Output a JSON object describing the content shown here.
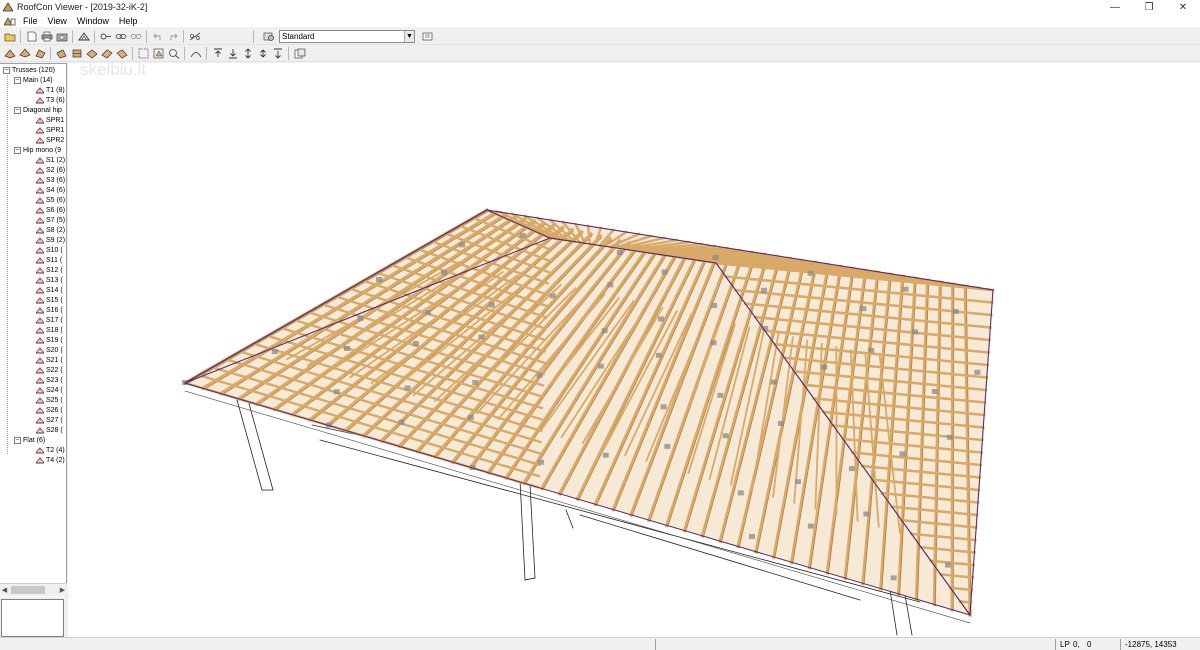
{
  "window": {
    "title": "RoofCon Viewer - [2019-32-iK-2]",
    "controls": {
      "minimize": "—",
      "restore": "❐",
      "close": "✕"
    }
  },
  "menu": [
    "File",
    "View",
    "Window",
    "Help"
  ],
  "toolbar": {
    "view_mode": "Standard",
    "icons_row1": [
      "open-icon",
      "new-icon",
      "print-icon",
      "camera-icon",
      "truss-view-icon",
      "key-icon",
      "link-icon",
      "unlink-icon",
      "undo-icon",
      "redo-icon",
      "measure-icon",
      "settings-icon"
    ],
    "icons_row2": [
      "view-front-icon",
      "view-back-icon",
      "view-left-icon",
      "view-right-icon",
      "view-top-icon",
      "view-iso1-icon",
      "view-iso2-icon",
      "view-iso3-icon",
      "zoom-window-icon",
      "zoom-all-icon",
      "zoom-in-icon",
      "pan-icon",
      "rotate-icon",
      "roof-icon",
      "arrow-up-icon",
      "arrow-down-icon",
      "arrow-left-icon",
      "arrow-right-icon",
      "arrow-both-icon",
      "export-icon"
    ]
  },
  "tree": {
    "root": "Trusses (120)",
    "groups": [
      {
        "label": "Main (14)",
        "items": [
          "T1 (8)",
          "T3 (6)"
        ]
      },
      {
        "label": "Diagonal hip",
        "items": [
          "SPR1",
          "SPR1",
          "SPR2"
        ]
      },
      {
        "label": "Hip mono (9",
        "items": [
          "S1 (2)",
          "S2 (6)",
          "S3 (6)",
          "S4 (6)",
          "S5 (6)",
          "S6 (6)",
          "S7 (5)",
          "S8 (2)",
          "S9 (2)",
          "S10 (",
          "S11 (",
          "S12 (",
          "S13 (",
          "S14 (",
          "S15 (",
          "S16 (",
          "S17 (",
          "S18 (",
          "S19 (",
          "S20 (",
          "S21 (",
          "S22 (",
          "S23 (",
          "S24 (",
          "S25 (",
          "S26 (",
          "S27 (",
          "S28 ("
        ]
      },
      {
        "label": "Flat (6)",
        "items": [
          "T2 (4)",
          "T4 (2)"
        ]
      }
    ]
  },
  "watermark": "skelbiu.lt",
  "status": {
    "mode": "LP",
    "x": "0,",
    "y": "0",
    "coords": "-12875, 14353"
  },
  "colors": {
    "timber": "#d9a968",
    "timber_dark": "#a8743a",
    "plate": "#8a8a8a",
    "ridge": "#5a2a6a"
  }
}
